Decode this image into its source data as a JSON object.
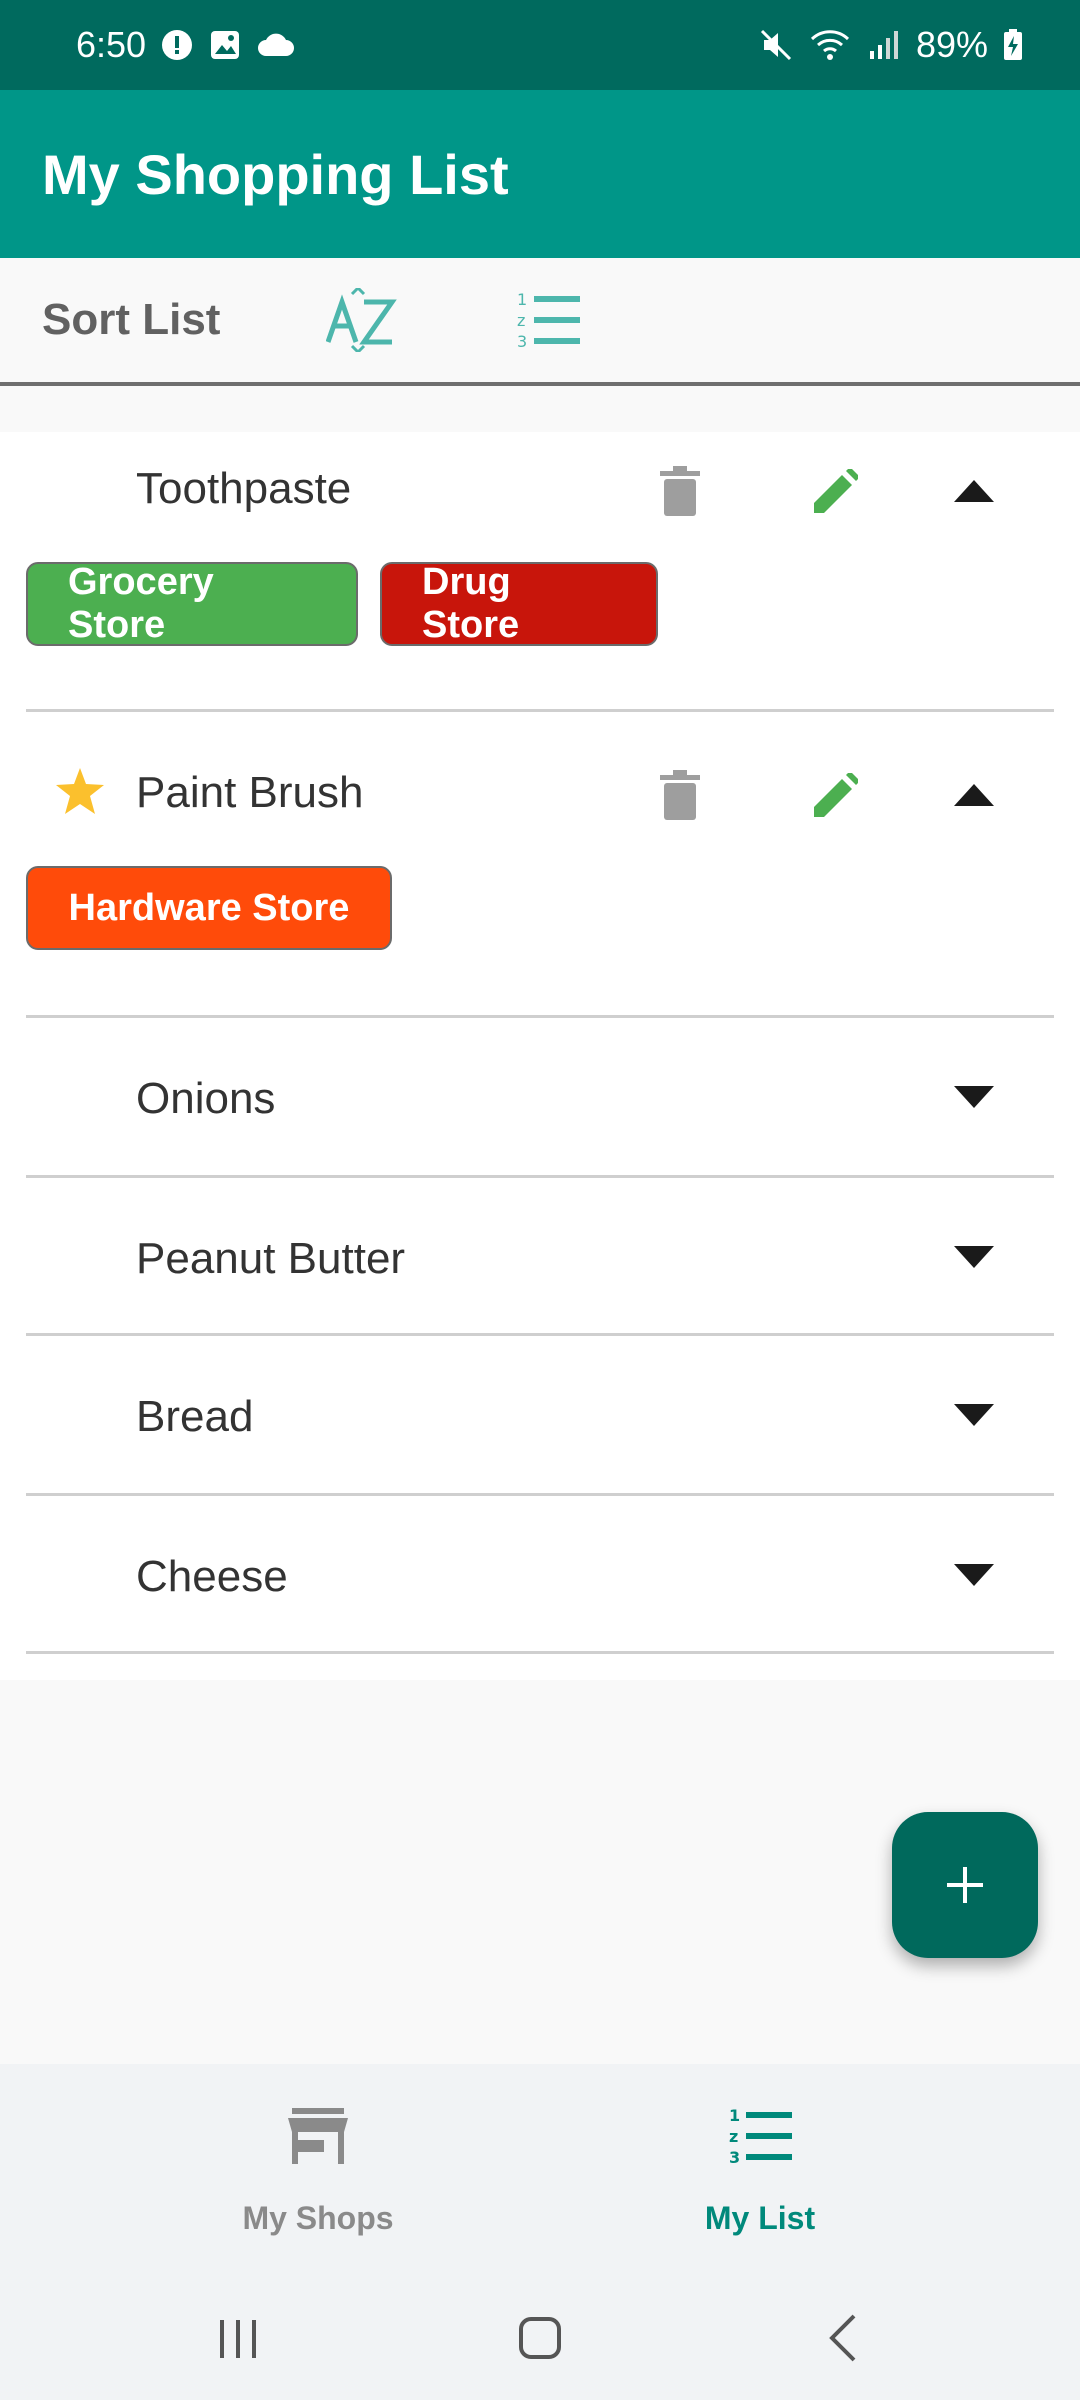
{
  "status_bar": {
    "time": "6:50",
    "battery": "89%"
  },
  "app_bar": {
    "title": "My Shopping List"
  },
  "sort_bar": {
    "label": "Sort List"
  },
  "items": [
    {
      "name": "Toothpaste",
      "starred": false,
      "expanded": true,
      "stores": [
        {
          "label": "Grocery Store",
          "color": "#4caf50"
        },
        {
          "label": "Drug Store",
          "color": "#c8150b"
        }
      ]
    },
    {
      "name": "Paint Brush",
      "starred": true,
      "expanded": true,
      "stores": [
        {
          "label": "Hardware Store",
          "color": "#ff4b0a"
        }
      ]
    },
    {
      "name": "Onions",
      "expanded": false
    },
    {
      "name": "Peanut Butter",
      "expanded": false
    },
    {
      "name": "Bread",
      "expanded": false
    },
    {
      "name": "Cheese",
      "expanded": false
    }
  ],
  "bottom_nav": {
    "shops": "My Shops",
    "list": "My List",
    "active": "list"
  },
  "colors": {
    "primary": "#009688",
    "primary_dark": "#006a5e",
    "fab": "#00695c",
    "edit": "#4caf50",
    "star": "#fbc02d"
  },
  "icons": [
    "trash-icon",
    "pencil-icon",
    "chevron-up-icon",
    "chevron-down-icon",
    "star-icon",
    "plus-icon",
    "store-icon",
    "numbered-list-icon",
    "sort-az-icon"
  ]
}
